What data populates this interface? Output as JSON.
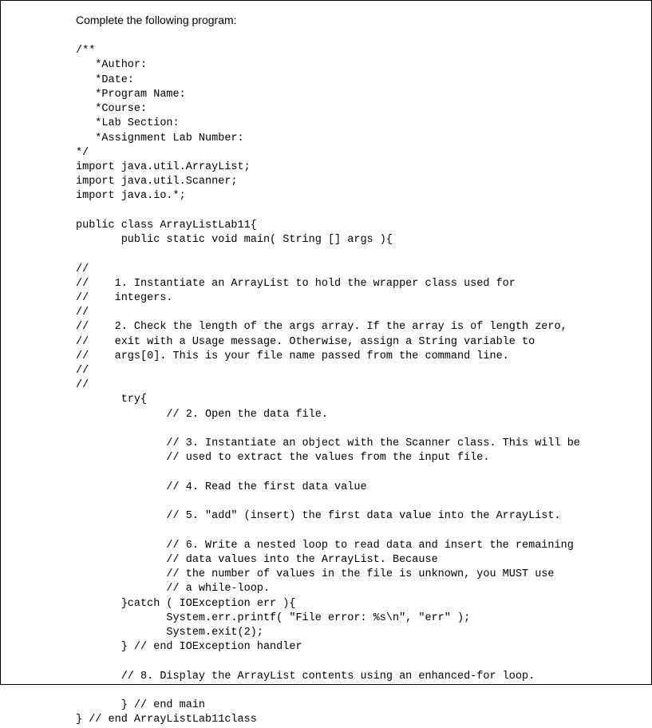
{
  "instruction": "Complete the following program:",
  "code": {
    "l01": "/**",
    "l02": "   *Author:",
    "l03": "   *Date:",
    "l04": "   *Program Name:",
    "l05": "   *Course:",
    "l06": "   *Lab Section:",
    "l07": "   *Assignment Lab Number:",
    "l08": "*/",
    "l09": "import java.util.ArrayList;",
    "l10": "import java.util.Scanner;",
    "l11": "import java.io.*;",
    "l12": "",
    "l13": "public class ArrayListLab11{",
    "l14": "       public static void main( String [] args ){",
    "l15": "",
    "l16": "//",
    "l17": "//    1. Instantiate an ArrayList to hold the wrapper class used for",
    "l18": "//    integers.",
    "l19": "//",
    "l20": "//    2. Check the length of the args array. If the array is of length zero,",
    "l21": "//    exit with a Usage message. Otherwise, assign a String variable to",
    "l22": "//    args[0]. This is your file name passed from the command line.",
    "l23": "//",
    "l24": "//",
    "l25": "       try{",
    "l26": "              // 2. Open the data file.",
    "l27": "",
    "l28": "              // 3. Instantiate an object with the Scanner class. This will be",
    "l29": "              // used to extract the values from the input file.",
    "l30": "",
    "l31": "              // 4. Read the first data value",
    "l32": "",
    "l33": "              // 5. \"add\" (insert) the first data value into the ArrayList.",
    "l34": "",
    "l35": "              // 6. Write a nested loop to read data and insert the remaining",
    "l36": "              // data values into the ArrayList. Because",
    "l37": "              // the number of values in the file is unknown, you MUST use",
    "l38": "              // a while-loop.",
    "l39": "       }catch ( IOException err ){",
    "l40": "              System.err.printf( \"File error: %s\\n\", \"err\" );",
    "l41": "              System.exit(2);",
    "l42": "       } // end IOException handler",
    "l43": "",
    "l44": "       // 8. Display the ArrayList contents using an enhanced-for loop.",
    "l45": "",
    "l46": "       } // end main",
    "l47": "} // end ArrayListLab11class"
  }
}
